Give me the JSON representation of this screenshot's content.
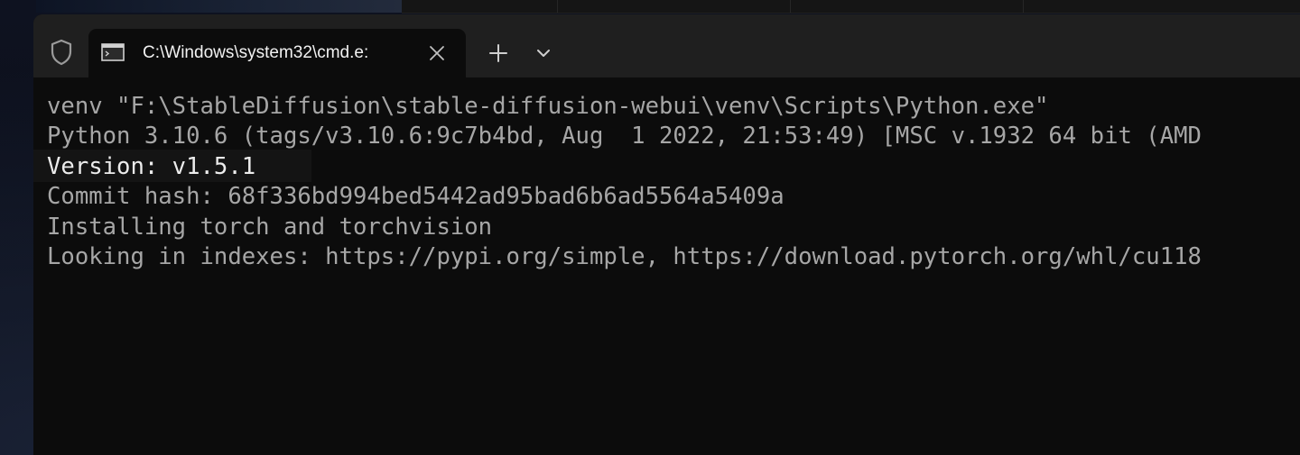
{
  "window": {
    "tab": {
      "title": "C:\\Windows\\system32\\cmd.e:",
      "icon": "cmd-window-icon",
      "close_icon": "close-icon"
    },
    "new_tab_icon": "plus-icon",
    "dropdown_icon": "chevron-down-icon",
    "shield_icon": "shield-icon"
  },
  "terminal": {
    "lines": [
      "venv \"F:\\StableDiffusion\\stable-diffusion-webui\\venv\\Scripts\\Python.exe\"",
      "Python 3.10.6 (tags/v3.10.6:9c7b4bd, Aug  1 2022, 21:53:49) [MSC v.1932 64 bit (AMD",
      "Version: v1.5.1",
      "Commit hash: 68f336bd994bed5442ad95bad6b6ad5564a5409a",
      "Installing torch and torchvision",
      "Looking in indexes: https://pypi.org/simple, https://download.pytorch.org/whl/cu118"
    ]
  },
  "colors": {
    "terminal_bg": "#0c0c0c",
    "titlebar_bg": "#1f1f1f",
    "text_dim": "#a6a6a6",
    "text_bright": "#ececec"
  }
}
